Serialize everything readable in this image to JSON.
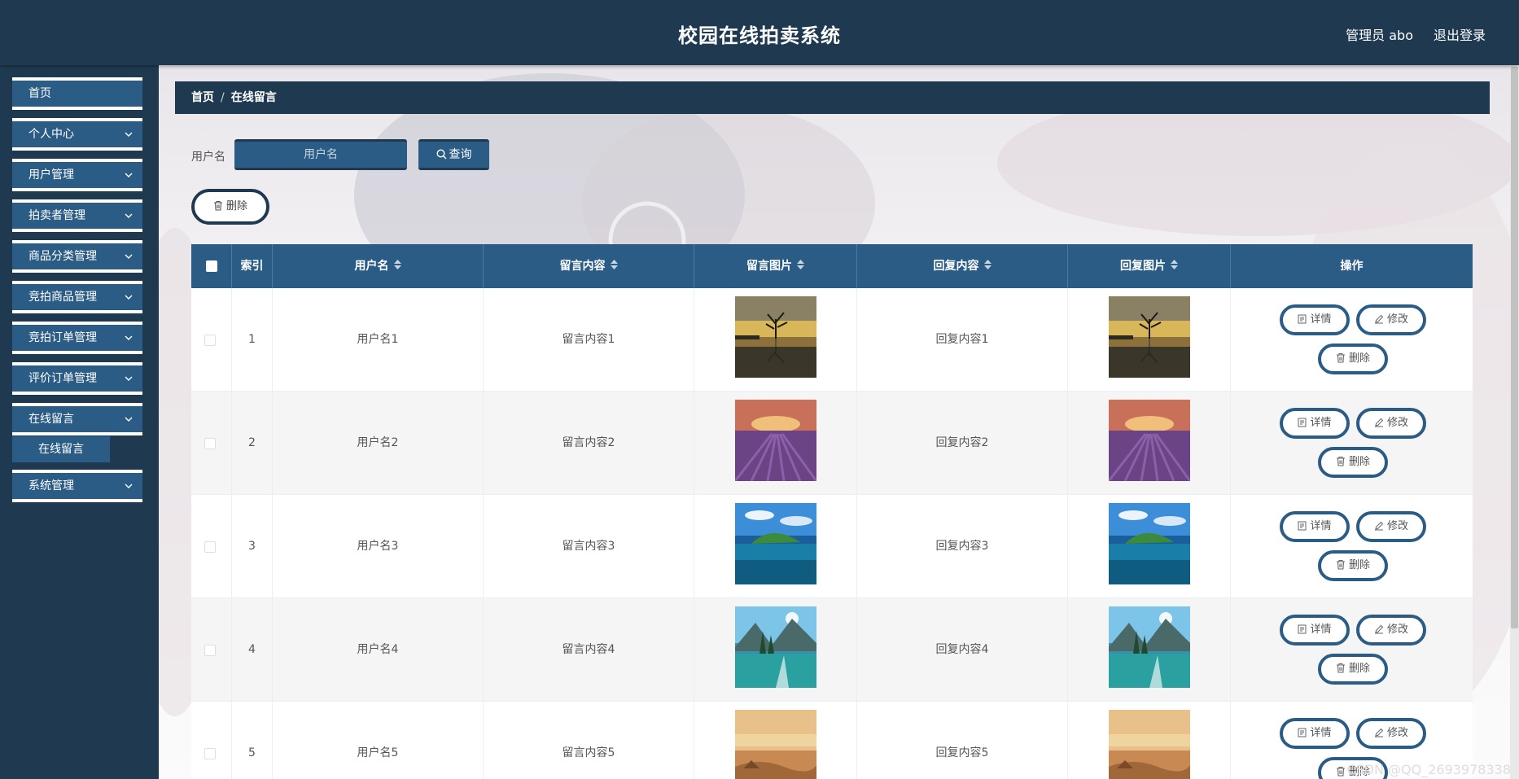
{
  "header": {
    "title": "校园在线拍卖系统",
    "user_label": "管理员 abo",
    "logout_label": "退出登录"
  },
  "sidebar": {
    "items": [
      {
        "label": "首页",
        "has_children": false
      },
      {
        "label": "个人中心",
        "has_children": true
      },
      {
        "label": "用户管理",
        "has_children": true
      },
      {
        "label": "拍卖者管理",
        "has_children": true
      },
      {
        "label": "商品分类管理",
        "has_children": true
      },
      {
        "label": "竞拍商品管理",
        "has_children": true
      },
      {
        "label": "竞拍订单管理",
        "has_children": true
      },
      {
        "label": "评价订单管理",
        "has_children": true
      },
      {
        "label": "在线留言",
        "has_children": true
      },
      {
        "label": "系统管理",
        "has_children": true
      }
    ],
    "active_sub_item": "在线留言"
  },
  "breadcrumb": {
    "home": "首页",
    "separator": "/",
    "current": "在线留言"
  },
  "search": {
    "label": "用户名",
    "placeholder": "用户名",
    "query_label": "查询"
  },
  "toolbar": {
    "delete_label": "删除"
  },
  "table": {
    "columns": [
      "索引",
      "用户名",
      "留言内容",
      "留言图片",
      "回复内容",
      "回复图片",
      "操作"
    ],
    "rows": [
      {
        "index": "1",
        "username": "用户名1",
        "content": "留言内容1",
        "reply": "回复内容1",
        "image": "lake-tree"
      },
      {
        "index": "2",
        "username": "用户名2",
        "content": "留言内容2",
        "reply": "回复内容2",
        "image": "lavender-field"
      },
      {
        "index": "3",
        "username": "用户名3",
        "content": "留言内容3",
        "reply": "回复内容3",
        "image": "tropical-island"
      },
      {
        "index": "4",
        "username": "用户名4",
        "content": "留言内容4",
        "reply": "回复内容4",
        "image": "mountain-lake"
      },
      {
        "index": "5",
        "username": "用户名5",
        "content": "留言内容5",
        "reply": "回复内容5",
        "image": "desert-sunset"
      }
    ],
    "actions": {
      "detail_label": "详情",
      "edit_label": "修改",
      "delete_label": "删除"
    }
  },
  "watermark": "CSDN @QQ_2693978338",
  "colors": {
    "dark_navy": "#1f3a50",
    "primary_blue": "#2b5c85",
    "white": "#ffffff"
  }
}
